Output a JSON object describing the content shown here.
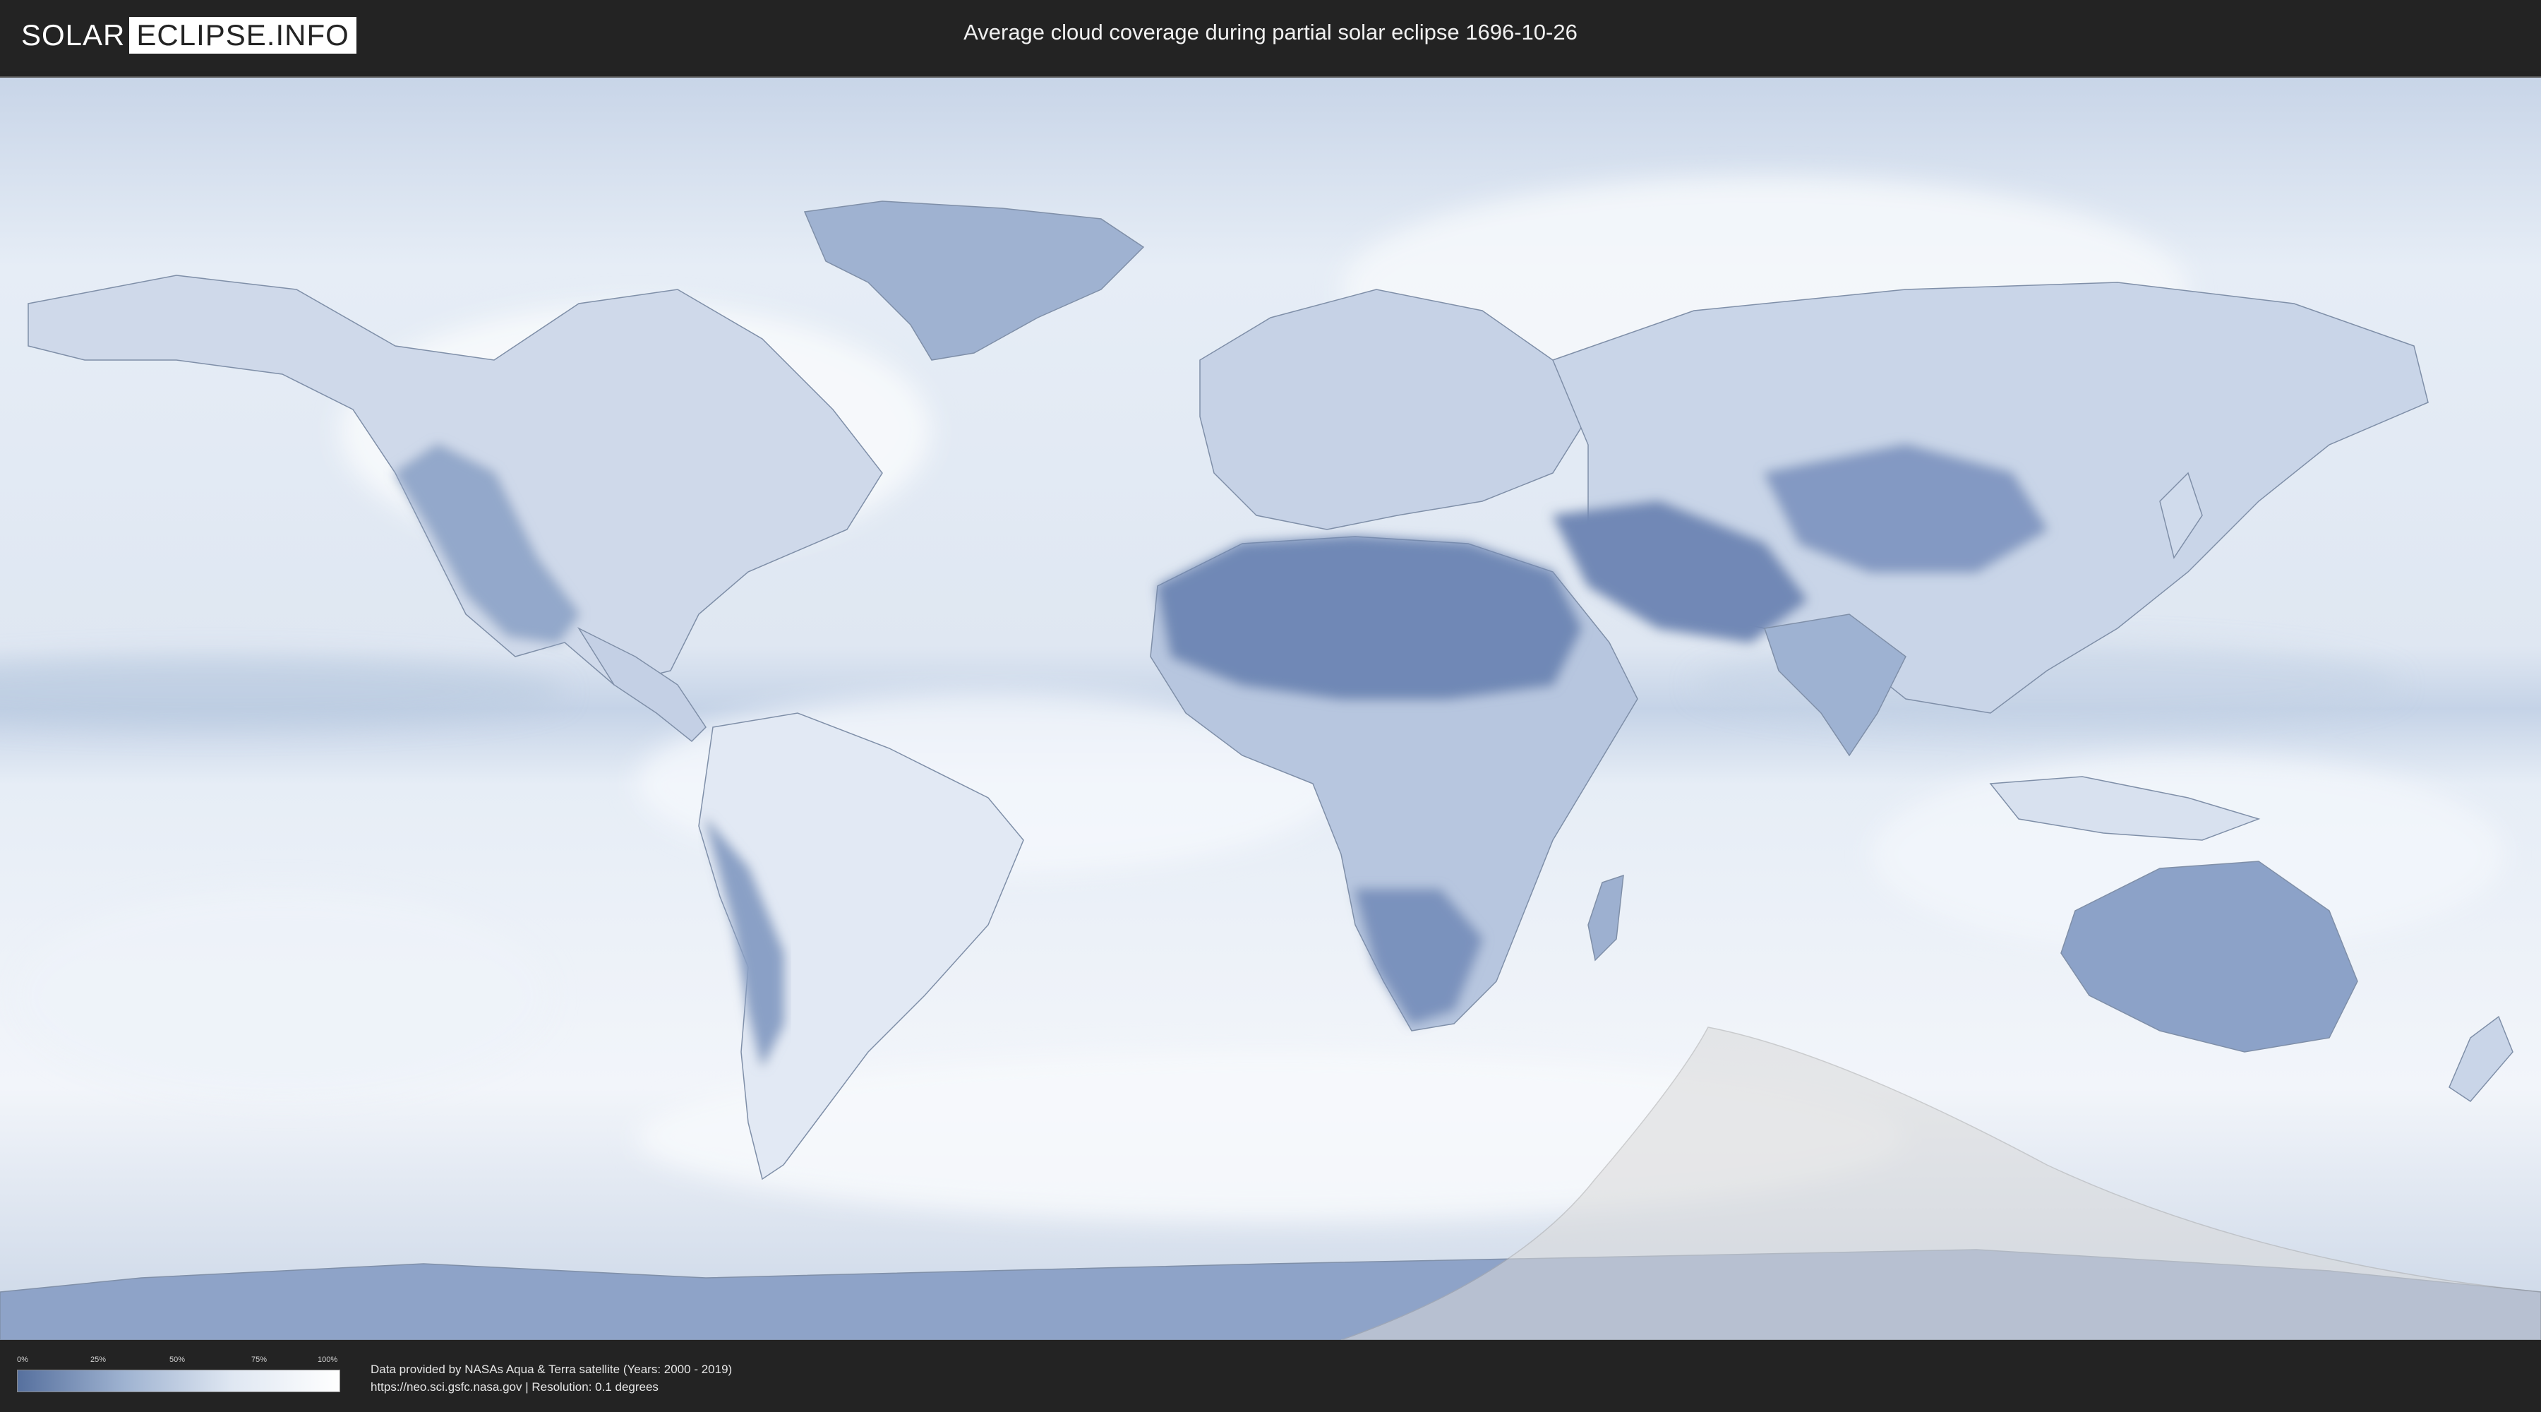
{
  "header": {
    "logo_left": "SOLAR",
    "logo_right": "ECLIPSE.INFO",
    "title": "Average cloud coverage during partial solar eclipse 1696-10-26"
  },
  "legend": {
    "ticks": [
      "0%",
      "25%",
      "50%",
      "75%",
      "100%"
    ],
    "color_low": "#56709e",
    "color_high": "#ffffff"
  },
  "footer": {
    "line1": "Data provided by NASAs Aqua & Terra satellite (Years: 2000 - 2019)",
    "line2": "https://neo.sci.gsfc.nasa.gov | Resolution: 0.1 degrees"
  },
  "map": {
    "ocean_color": "#e8eef6",
    "land_cloud_low_color": "#6d86b4",
    "eclipse_zone_color": "#d9d9d9"
  }
}
